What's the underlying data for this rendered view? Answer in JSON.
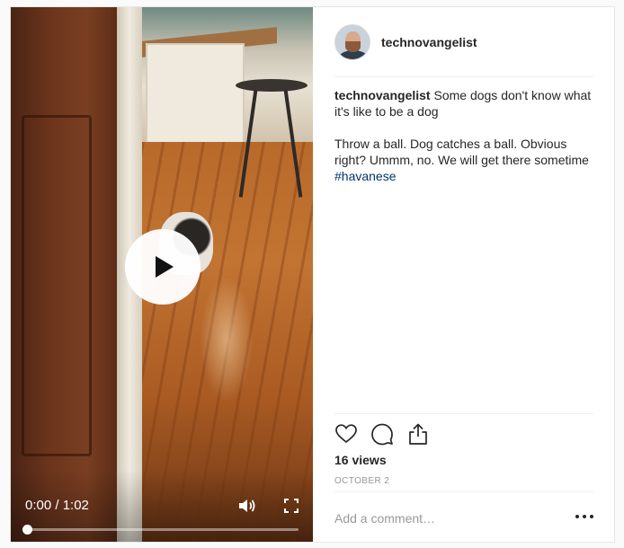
{
  "post": {
    "username": "technovangelist",
    "caption_line1": "Some dogs don't know what it's like to be a dog",
    "caption_line2": "Throw a ball. Dog catches a ball. Obvious right? Ummm, no. We will get there sometime",
    "hashtag": "#havanese",
    "views": "16 views",
    "date": "OCTOBER 2",
    "comment_placeholder": "Add a comment…"
  },
  "video": {
    "time": "0:00 / 1:02",
    "progress": 0.0
  },
  "icons": {
    "play": "play-icon",
    "volume": "volume-icon",
    "fullscreen": "fullscreen-icon",
    "like": "heart-icon",
    "comment": "comment-icon",
    "share": "share-icon",
    "more": "more-options-icon"
  },
  "colors": {
    "hashtag": "#003569",
    "text": "#262626",
    "muted": "#999999"
  }
}
